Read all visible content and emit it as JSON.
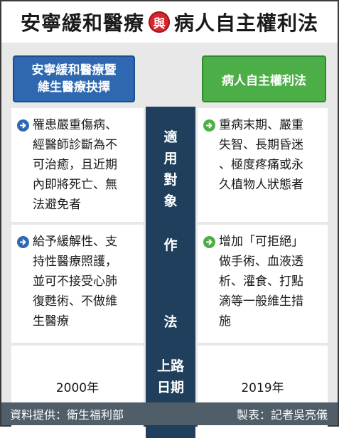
{
  "title": {
    "left": "安寧緩和醫療",
    "connector": "與",
    "right": "病人自主權利法"
  },
  "headers": {
    "left": [
      "安寧緩和醫療暨",
      "維生醫療抉擇"
    ],
    "right": "病人自主權利法"
  },
  "rows": {
    "target": {
      "label": [
        "適",
        "用",
        "對",
        "象"
      ],
      "left": [
        "罹患嚴重傷病、",
        "經醫師診斷為不",
        "可治癒，且近期",
        "內即將死亡、無",
        "法避免者"
      ],
      "right": [
        "重病末期、嚴重",
        "失智、長期昏迷",
        "、極度疼痛或永",
        "久植物人狀態者"
      ]
    },
    "practice": {
      "label_top": "作",
      "label_bottom": "法",
      "left": [
        "給予緩解性、支",
        "持性醫療照護，",
        "並可不接受心肺",
        "復甦術、不做維",
        "生醫療"
      ],
      "right": [
        "增加「可拒絕」",
        "做手術、血液透",
        "析、灌食、打點",
        "滴等一般維生措",
        "施"
      ]
    },
    "effective": {
      "label": [
        "上路",
        "日期"
      ],
      "left": "2000年",
      "right": "2019年"
    }
  },
  "footer": {
    "source": "資料提供：衛生福利部",
    "credit": "製表：記者吳亮儀"
  },
  "colors": {
    "blue": "#2e68b0",
    "green": "#4cae46",
    "navy": "#1f3f5c",
    "red": "#d8262e",
    "footer": "#4f5e68"
  },
  "icons": {
    "left_bullet": "arrow-right-circle-icon",
    "right_bullet": "arrow-right-circle-icon"
  }
}
